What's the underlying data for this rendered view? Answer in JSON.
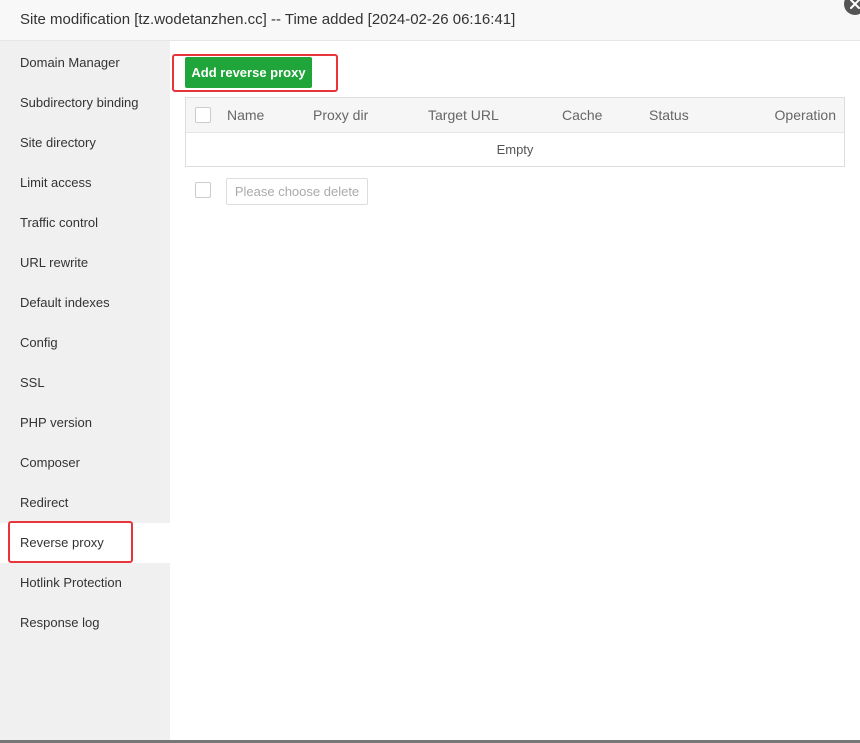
{
  "dialog": {
    "title": "Site modification [tz.wodetanzhen.cc] -- Time added [2024-02-26 06:16:41]"
  },
  "sidebar": {
    "items": [
      {
        "label": "Domain Manager"
      },
      {
        "label": "Subdirectory binding"
      },
      {
        "label": "Site directory"
      },
      {
        "label": "Limit access"
      },
      {
        "label": "Traffic control"
      },
      {
        "label": "URL rewrite"
      },
      {
        "label": "Default indexes"
      },
      {
        "label": "Config"
      },
      {
        "label": "SSL"
      },
      {
        "label": "PHP version"
      },
      {
        "label": "Composer"
      },
      {
        "label": "Redirect"
      },
      {
        "label": "Reverse proxy",
        "active": true
      },
      {
        "label": "Hotlink Protection"
      },
      {
        "label": "Response log"
      }
    ]
  },
  "toolbar": {
    "add_label": "Add reverse proxy"
  },
  "table": {
    "columns": [
      "Name",
      "Proxy dir",
      "Target URL",
      "Cache",
      "Status",
      "Operation"
    ],
    "empty_text": "Empty"
  },
  "batch": {
    "delete_label": "Please choose delete"
  },
  "colors": {
    "accent": "#20a53a",
    "highlight": "#e8353b"
  },
  "icons": {
    "close": "close-icon"
  }
}
